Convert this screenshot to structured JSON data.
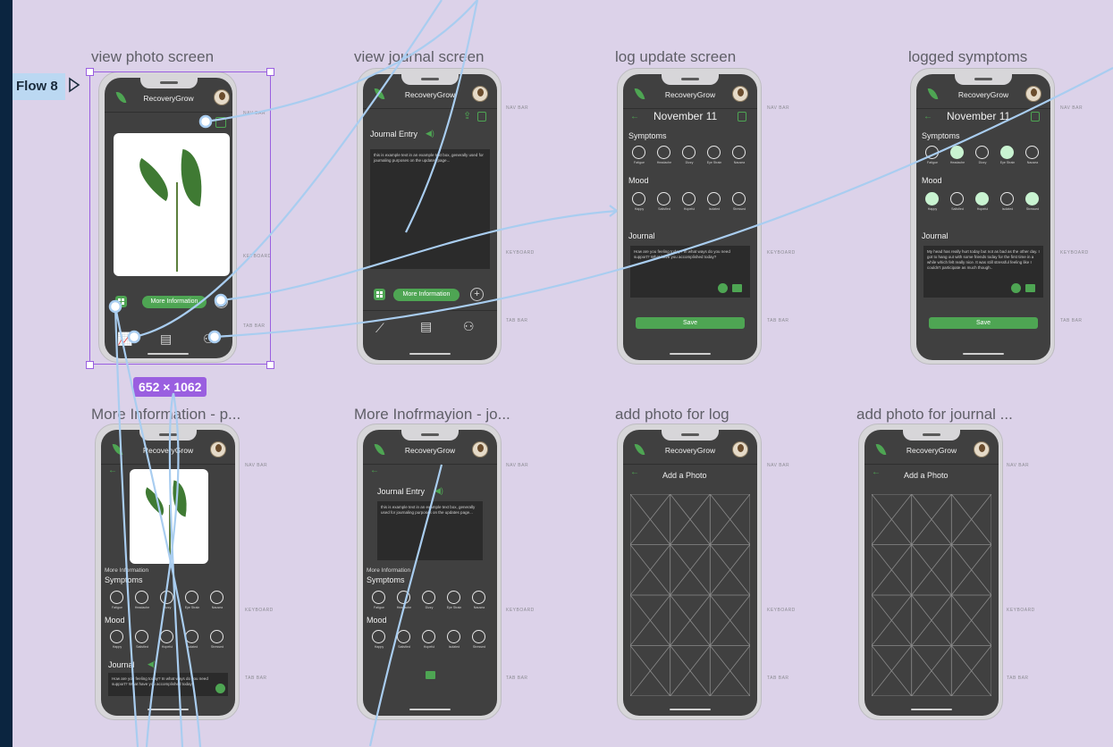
{
  "app_name": "RecoveryGrow",
  "flow": {
    "label": "Flow 8"
  },
  "selection": {
    "size": "652 × 1062"
  },
  "side_labels": {
    "nav": "NAV BAR",
    "keyboard": "KEYBOARD",
    "tab": "TAB BAR"
  },
  "frames": {
    "f1": {
      "title": "view photo screen",
      "more_btn": "More Information"
    },
    "f2": {
      "title": "view journal screen",
      "heading": "Journal Entry",
      "text": "this is example text in an example text box, generally used for journaling purposes on the updates page...",
      "more_btn": "More Information"
    },
    "f3": {
      "title": "log update screen",
      "date": "November 11",
      "symptoms": "Symptoms",
      "mood": "Mood",
      "journal": "Journal",
      "journal_text": "How are you feeling today? In what ways do you need support? What have you accomplished today?",
      "save": "Save"
    },
    "f4": {
      "title": "logged symptoms",
      "date": "November 11",
      "symptoms": "Symptoms",
      "mood": "Mood",
      "journal": "Journal",
      "journal_text": "My head has really hurt today but not as bad as the other day. I got to hang out with some friends today for the first time in a while which felt really nice. It was still stressful feeling like I couldn't participate as much though..",
      "save": "Save"
    },
    "f5": {
      "title": "More Information - p...",
      "more_info": "More Information",
      "symptoms": "Symptoms",
      "mood": "Mood",
      "journal": "Journal",
      "journal_text": "How are you feeling today? In what ways do you need support? What have you accomplished today?"
    },
    "f6": {
      "title": "More Inofrmayion - jo...",
      "heading": "Journal Entry",
      "text": "this is example text in an example text box, generally used for journaling purposes on the updates page...",
      "more_info": "More Information",
      "symptoms": "Symptoms",
      "mood": "Mood"
    },
    "f7": {
      "title": "add photo for log",
      "heading": "Add a Photo"
    },
    "f8": {
      "title": "add photo for journal ...",
      "heading": "Add a Photo"
    }
  },
  "symptom_labels": [
    "Fatigue",
    "Headache",
    "Dizzy",
    "Eye Strain",
    "Nausea"
  ],
  "mood_labels": [
    "Happy",
    "Satisfied",
    "Hopeful",
    "Isolated",
    "Stressed"
  ],
  "logged_symptom_states": [
    false,
    true,
    false,
    true,
    false
  ],
  "logged_mood_states": [
    true,
    false,
    true,
    false,
    true
  ],
  "colors": {
    "canvas": "#dcd2e9",
    "accent": "#4ea553",
    "selection": "#9a5fe0",
    "connector": "#a9cdf0",
    "screen": "#404040"
  },
  "icons": {
    "share": "share-icon",
    "trash": "trash-icon",
    "speaker": "speaker-icon",
    "grid": "grid-icon",
    "plus": "plus-icon",
    "chart": "chart-icon",
    "journal": "journal-icon",
    "people": "people-icon",
    "mic": "mic-icon",
    "image": "image-icon",
    "back": "back-arrow-icon",
    "play": "play-icon"
  }
}
